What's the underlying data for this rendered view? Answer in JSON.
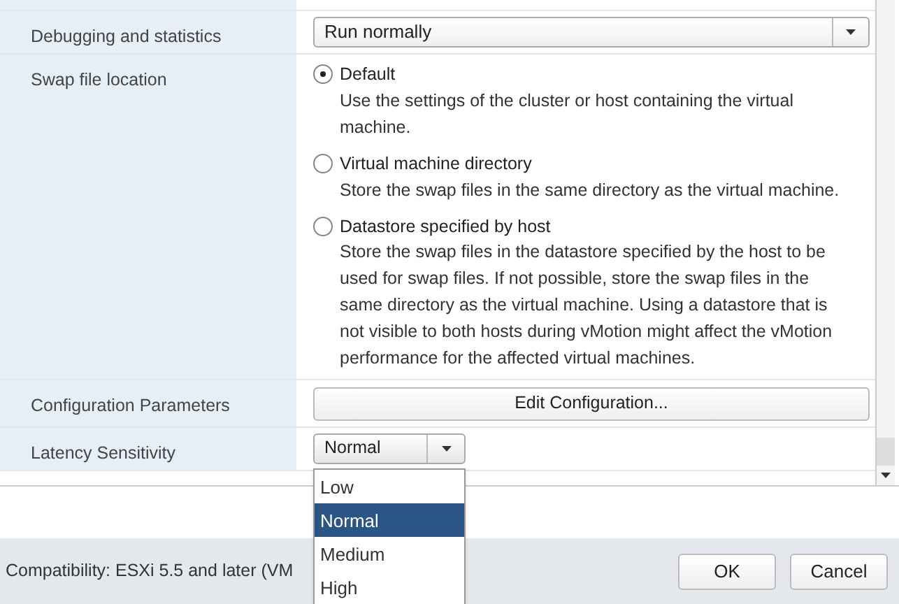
{
  "rows": [
    {
      "kind": "select",
      "label": "Debugging and statistics",
      "value": "Run normally"
    },
    {
      "kind": "radios",
      "label": "Swap file location",
      "options": [
        {
          "title": "Default",
          "description": "Use the settings of the cluster or host containing the virtual machine.",
          "selected": true
        },
        {
          "title": "Virtual machine directory",
          "description": "Store the swap files in the same directory as the virtual machine.",
          "selected": false
        },
        {
          "title": "Datastore specified by host",
          "description": "Store the swap files in the datastore specified by the host to be used for swap files. If not possible, store the swap files in the same directory as the virtual machine. Using a datastore that is not visible to both hosts during vMotion might affect the vMotion performance for the affected virtual machines.",
          "selected": false
        }
      ]
    },
    {
      "kind": "button",
      "label": "Configuration Parameters",
      "value": "Edit Configuration..."
    },
    {
      "kind": "dropdown",
      "label": "Latency Sensitivity",
      "value": "Normal",
      "options": [
        {
          "label": "Low",
          "selected": false
        },
        {
          "label": "Normal",
          "selected": true
        },
        {
          "label": "Medium",
          "selected": false
        },
        {
          "label": "High",
          "selected": false
        }
      ]
    }
  ],
  "footer": {
    "compatibility": "Compatibility: ESXi 5.5 and later (VM",
    "buttons": [
      "OK",
      "Cancel"
    ]
  }
}
